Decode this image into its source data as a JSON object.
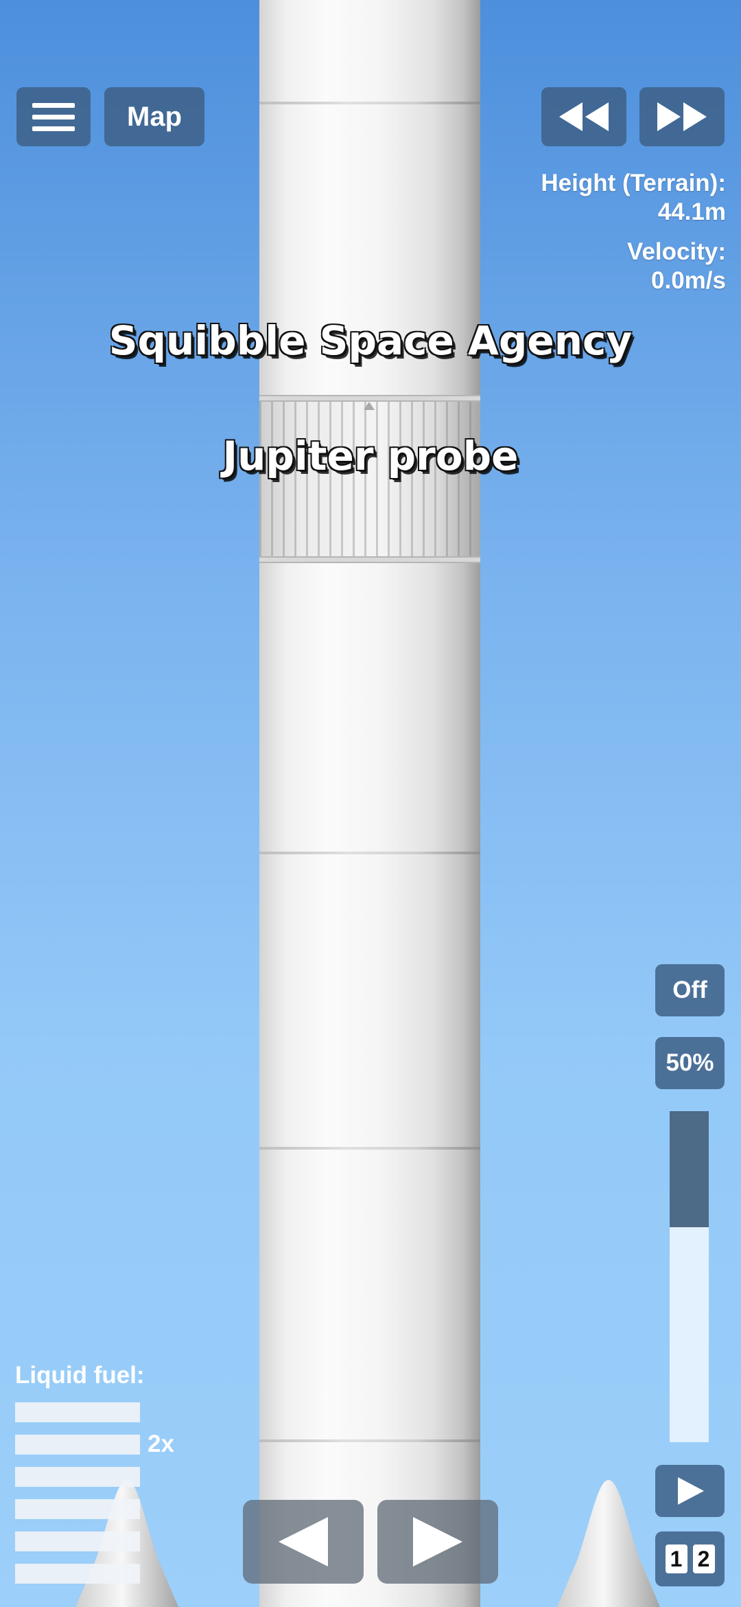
{
  "toolbar": {
    "menu_icon": "hamburger-menu-icon",
    "map_label": "Map",
    "rewind_icon": "rewind-icon",
    "fast_forward_icon": "fast-forward-icon"
  },
  "telemetry": {
    "height_label": "Height (Terrain):",
    "height_value": "44.1m",
    "velocity_label": "Velocity:",
    "velocity_value": "0.0m/s"
  },
  "craft": {
    "agency_name": "Squibble Space Agency",
    "craft_name": "Jupiter probe"
  },
  "controls": {
    "sas_label": "Off",
    "throttle_label": "50%",
    "throttle_level": 0.35,
    "stage_icon": "play-icon",
    "view_1": "1",
    "view_2": "2"
  },
  "fuel": {
    "label": "Liquid fuel:",
    "bars": [
      1,
      1,
      1,
      1,
      1,
      1
    ],
    "multiplier": "2x"
  },
  "navigation": {
    "prev_icon": "left-triangle-icon",
    "next_icon": "right-triangle-icon"
  },
  "colors": {
    "button_bg": "#3e6087",
    "throttle_fill": "#4d6a86",
    "sky_top": "#4d8fdc",
    "sky_bottom": "#9ccff9"
  }
}
